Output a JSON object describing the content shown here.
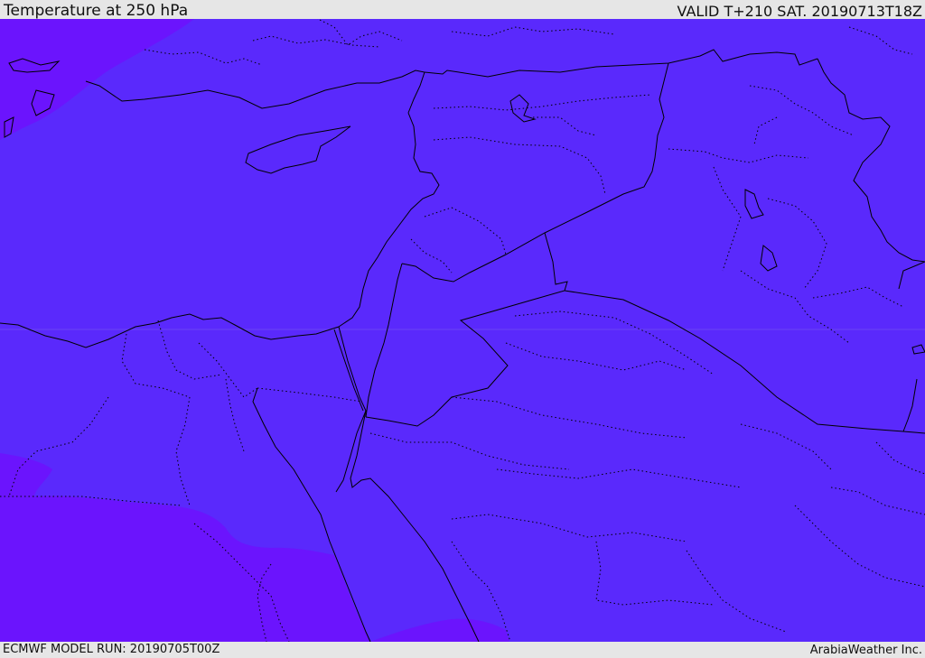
{
  "header": {
    "title": "Temperature at 250 hPa",
    "valid": "VALID T+210 SAT. 20190713T18Z"
  },
  "footer": {
    "model_run": "ECMWF MODEL RUN: 20190705T00Z",
    "credit": "ArabiaWeather Inc."
  },
  "colors": {
    "fill_main": "#5a29fc",
    "fill_cold": "#6b14fd",
    "border": "#000000",
    "bar": "#e6e6e6"
  }
}
